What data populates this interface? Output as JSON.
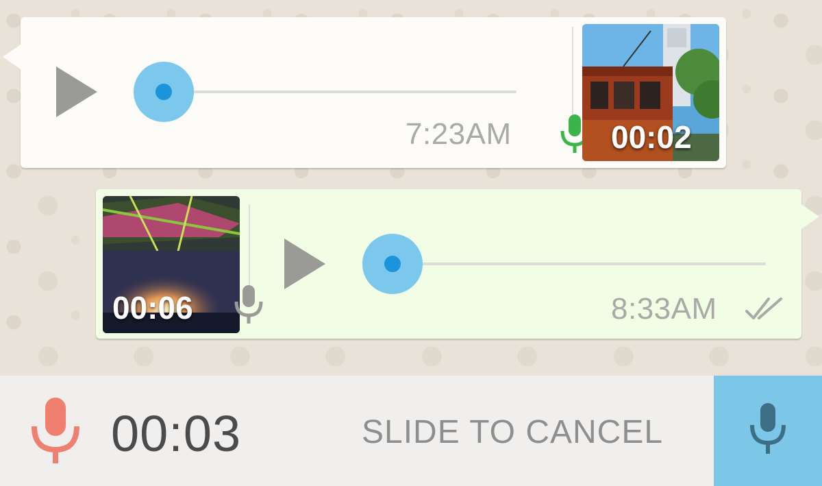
{
  "messages": [
    {
      "direction": "incoming",
      "type": "voice",
      "time": "7:23AM",
      "progress": 0,
      "mic_color": "#3bb54a",
      "media_duration": "00:02",
      "thumbnail": "tram-photo"
    },
    {
      "direction": "outgoing",
      "type": "voice",
      "time": "8:33AM",
      "progress": 0,
      "status_icon": "double-check-icon",
      "mic_color": "#9a9a97",
      "media_duration": "00:06",
      "thumbnail": "stage-lights-photo"
    }
  ],
  "recording": {
    "timer": "00:03",
    "slide_to_cancel": "SLIDE TO CANCEL",
    "mic_color": "#ef7f6f",
    "button_color": "#7cc7e8",
    "button_icon": "mic-icon"
  },
  "colors": {
    "incoming_bubble": "#fdfcf8",
    "outgoing_bubble": "#f2fde6",
    "knob": "#7cc8ec",
    "knob_dot": "#1b94dc"
  }
}
